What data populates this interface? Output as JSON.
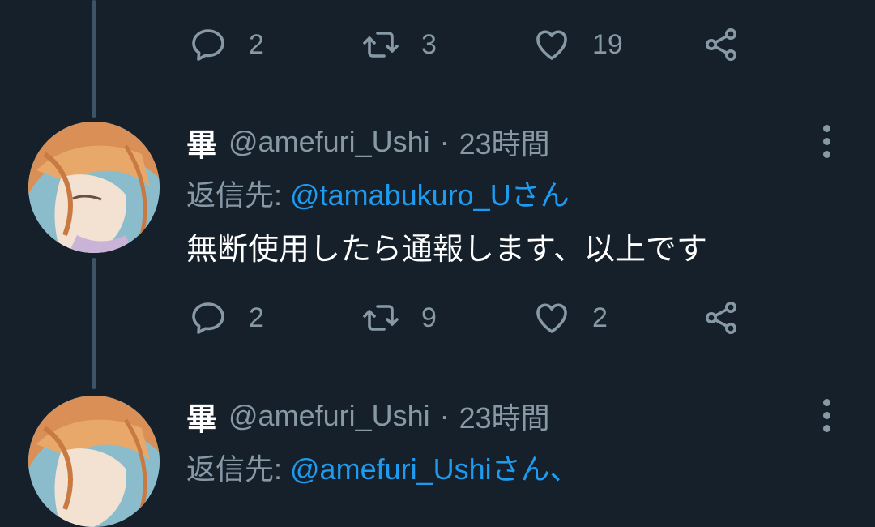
{
  "colors": {
    "background": "#15202b",
    "text_secondary": "#8899a6",
    "text_primary": "#ffffff",
    "link": "#1d9bf0",
    "thread_line": "#3d5466"
  },
  "top_actions": {
    "reply_count": "2",
    "retweet_count": "3",
    "like_count": "19"
  },
  "tweets": [
    {
      "name": "畢",
      "handle": "@amefuri_Ushi",
      "separator": "·",
      "time": "23時間",
      "replying_prefix": "返信先: ",
      "replying_mention": "@tamabukuro_U",
      "replying_suffix": "さん",
      "text": "無断使用したら通報します、以上です",
      "reply_count": "2",
      "retweet_count": "9",
      "like_count": "2"
    },
    {
      "name": "畢",
      "handle": "@amefuri_Ushi",
      "separator": "·",
      "time": "23時間",
      "replying_prefix": "返信先: ",
      "replying_mention": "@amefuri_Ushi",
      "replying_suffix": "さん、"
    }
  ],
  "icons": [
    "reply-icon",
    "retweet-icon",
    "like-icon",
    "share-icon",
    "more-icon",
    "avatar"
  ]
}
